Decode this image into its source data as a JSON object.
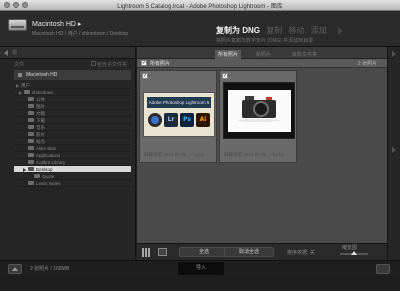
{
  "window": {
    "title": "Lightroom 5 Catalog.lrcat - Adobe Photoshop Lightroom - 图库"
  },
  "header": {
    "source_name": "Macintosh HD",
    "source_arrow": "▸",
    "source_path": "Macintosh HD / 用户 / shinedown / Desktop",
    "modes": [
      {
        "label": "复制为 DNG",
        "active": true
      },
      {
        "label": "复制",
        "active": false
      },
      {
        "label": "移动",
        "active": false
      },
      {
        "label": "添加",
        "active": false
      }
    ],
    "mode_description": "将照片复制为数字负片 (DNG) 并添加到目录"
  },
  "left_panel": {
    "strip_label": "源",
    "files_label": "文件",
    "include_subfolders": "包含子文件夹",
    "volume": "Macintosh HD",
    "tree": [
      {
        "label": "用户",
        "indent": 0,
        "selected": false
      },
      {
        "label": "shinedown",
        "indent": 1,
        "selected": false
      },
      {
        "label": "公共",
        "indent": 2,
        "selected": false
      },
      {
        "label": "图片",
        "indent": 2,
        "selected": false
      },
      {
        "label": "文稿",
        "indent": 2,
        "selected": false
      },
      {
        "label": "下载",
        "indent": 2,
        "selected": false
      },
      {
        "label": "音乐",
        "indent": 2,
        "selected": false
      },
      {
        "label": "影片",
        "indent": 2,
        "selected": false
      },
      {
        "label": "站点",
        "indent": 2,
        "selected": false
      },
      {
        "label": "Alien Skin",
        "indent": 2,
        "selected": false
      },
      {
        "label": "Applications",
        "indent": 2,
        "selected": false
      },
      {
        "label": "Calibre Library",
        "indent": 2,
        "selected": false
      },
      {
        "label": "Desktop",
        "indent": 2,
        "selected": true
      },
      {
        "label": "Quote",
        "indent": 3,
        "selected": false
      },
      {
        "label": "Learn Notes",
        "indent": 2,
        "selected": false
      }
    ]
  },
  "grid": {
    "tabs": [
      "所有照片",
      "新照片",
      "目标文件夹"
    ],
    "select_label": "所有照片",
    "count_label": "2 张照片",
    "photos": [
      {
        "banner_text": "Adobe Photoshop Lightroom 5",
        "apps": [
          "",
          "Lr",
          "Ps",
          "Ai"
        ],
        "caption": "屏幕快照 2014-01-22 ... 4.png",
        "checked": "✓"
      },
      {
        "caption": "屏幕快照 2014-01-22 ... 8.png",
        "checked": "✓"
      }
    ]
  },
  "toolbar": {
    "check_all": "全选",
    "uncheck_all": "取消全选",
    "sort_label": "排序依据: 关",
    "thumbnails_label": "缩览图",
    "thumbnail_size": 0.5
  },
  "bottom_bar": {
    "info": "2 张照片 / 168MB",
    "import_label": "导入",
    "colors": {
      "accent": "#f0f0f0",
      "selected_folder": "#d9d9d9"
    }
  }
}
